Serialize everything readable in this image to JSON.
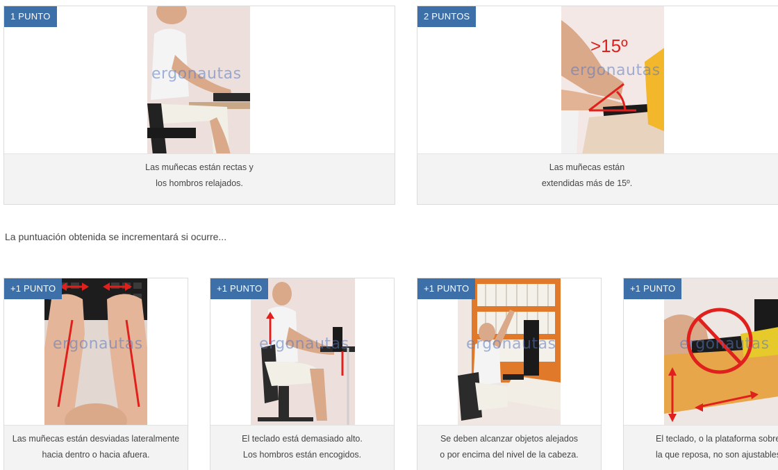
{
  "top_cards": [
    {
      "badge": "1 PUNTO",
      "caption_line1": "Las muñecas están rectas y",
      "caption_line2": "los hombros relajados.",
      "image": "person-seated-straight-wrists"
    },
    {
      "badge": "2 PUNTOS",
      "caption_line1": "Las muñecas están",
      "caption_line2": "extendidas más de 15º.",
      "image": "wrist-extended-angle",
      "angle_label": ">15º"
    }
  ],
  "intro_text": "La puntuación obtenida se incrementará si ocurre...",
  "bottom_cards": [
    {
      "badge": "+1 PUNTO",
      "caption_line1": "Las muñecas están desviadas lateralmente",
      "caption_line2": "hacia dentro o hacia afuera.",
      "image": "hands-lateral-deviation"
    },
    {
      "badge": "+1 PUNTO",
      "caption_line1": "El teclado está demasiado alto.",
      "caption_line2": "Los hombros están encogidos.",
      "image": "shoulders-raised"
    },
    {
      "badge": "+1 PUNTO",
      "caption_line1": "Se deben alcanzar objetos alejados",
      "caption_line2": "o por encima del nivel de la cabeza.",
      "image": "reaching-overhead"
    },
    {
      "badge": "+1 PUNTO",
      "caption_line1": "El teclado, o la plataforma sobre",
      "caption_line2": "la que reposa, no son ajustables.",
      "image": "keyboard-not-adjustable"
    }
  ],
  "watermark": "ergonautas",
  "colors": {
    "badge_bg": "#3d6fa8",
    "caption_bg": "#f3f3f3",
    "accent_red": "#e0201c"
  }
}
